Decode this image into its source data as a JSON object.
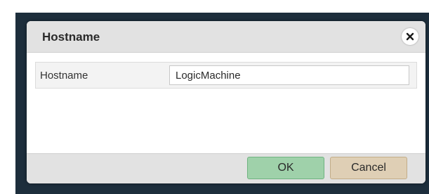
{
  "dialog": {
    "title": "Hostname",
    "close_icon": "close-icon"
  },
  "form": {
    "hostname": {
      "label": "Hostname",
      "value": "LogicMachine"
    }
  },
  "footer": {
    "ok_label": "OK",
    "cancel_label": "Cancel"
  },
  "colors": {
    "backdrop": "#1d2e3c",
    "header_bg": "#e2e2e2",
    "ok_bg": "#9fd1aa",
    "cancel_bg": "#dfcfb5"
  }
}
